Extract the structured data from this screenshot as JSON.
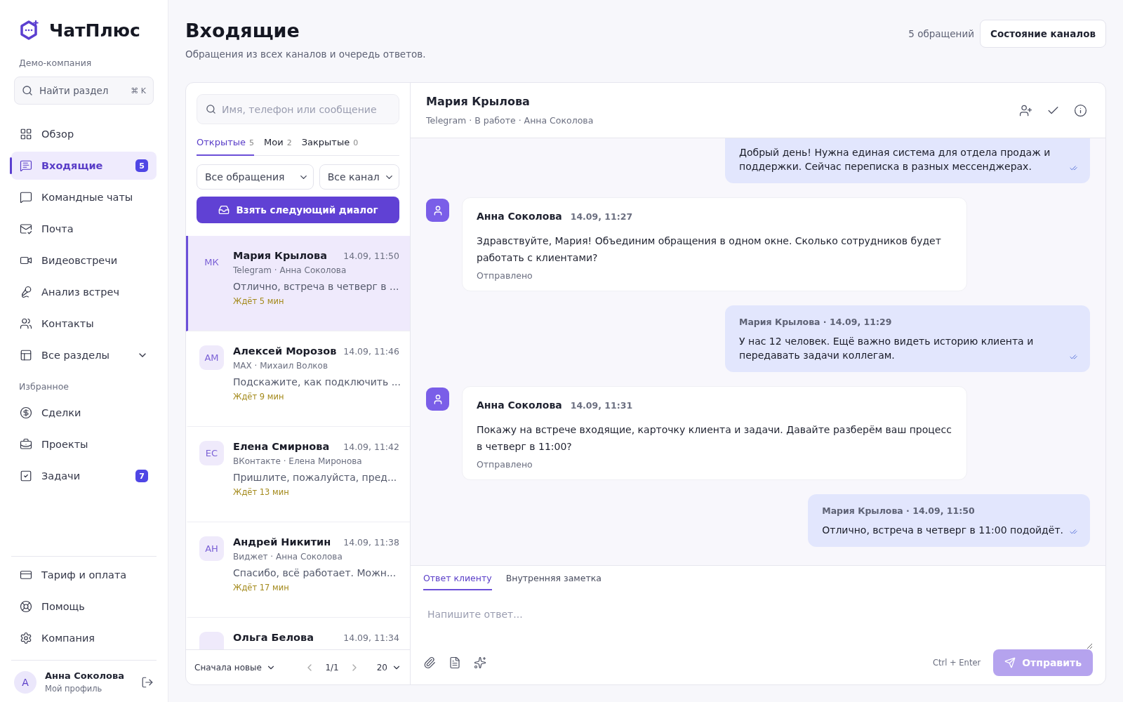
{
  "brand": {
    "name": "ЧатПлюс",
    "company": "Демо-компания"
  },
  "sidebar": {
    "search": {
      "placeholder": "Найти раздел",
      "shortcut": "⌘ K"
    },
    "items": [
      {
        "kind": "overview",
        "label": "Обзор",
        "selected": false
      },
      {
        "kind": "inbox",
        "label": "Входящие",
        "selected": true,
        "badge": "5"
      },
      {
        "kind": "team",
        "label": "Командные чаты",
        "selected": false
      },
      {
        "kind": "mail",
        "label": "Почта",
        "selected": false
      },
      {
        "kind": "video",
        "label": "Видеовстречи",
        "selected": false
      },
      {
        "kind": "analysis",
        "label": "Анализ встреч",
        "selected": false
      },
      {
        "kind": "contacts",
        "label": "Контакты",
        "selected": false
      },
      {
        "kind": "all",
        "label": "Все разделы",
        "selected": false,
        "expandable": true
      }
    ],
    "favorites_label": "Избранное",
    "favorites": [
      {
        "kind": "deals",
        "label": "Сделки",
        "selected": false
      },
      {
        "kind": "projects",
        "label": "Проекты",
        "selected": false
      },
      {
        "kind": "tasks",
        "label": "Задачи",
        "selected": false,
        "badge": "7"
      }
    ],
    "bottom": [
      {
        "kind": "billing",
        "label": "Тариф и оплата"
      },
      {
        "kind": "help",
        "label": "Помощь"
      },
      {
        "kind": "company",
        "label": "Компания"
      }
    ],
    "profile": {
      "initial": "А",
      "name": "Анна Соколова",
      "subtitle": "Мой профиль"
    }
  },
  "header": {
    "title": "Входящие",
    "subtitle": "Обращения из всех каналов и очередь ответов.",
    "count": "5 обращений",
    "button": "Состояние каналов"
  },
  "list": {
    "search": {
      "placeholder": "Имя, телефон или сообщение"
    },
    "tabs": [
      {
        "label": "Открытые",
        "count": "5",
        "selected": true
      },
      {
        "label": "Мои",
        "count": "2",
        "selected": false
      },
      {
        "label": "Закрытые",
        "count": "0",
        "selected": false
      }
    ],
    "filters": [
      "Все обращения",
      "Все канал"
    ],
    "take_button": "Взять следующий диалог",
    "conversations": [
      {
        "initials": "МК",
        "name": "Мария Крылова",
        "time": "14.09, 11:50",
        "meta": "Telegram · Анна Соколова",
        "preview": "Отлично, встреча в четверг в ...",
        "wait": "Ждёт 5 мин",
        "selected": true
      },
      {
        "initials": "АМ",
        "name": "Алексей Морозов",
        "time": "14.09, 11:46",
        "meta": "MAX · Михаил Волков",
        "preview": "Подскажите, как подключить ...",
        "wait": "Ждёт 9 мин",
        "selected": false
      },
      {
        "initials": "ЕС",
        "name": "Елена Смирнова",
        "time": "14.09, 11:42",
        "meta": "ВКонтакте · Елена Миронова",
        "preview": "Пришлите, пожалуйста, пред...",
        "wait": "Ждёт 13 мин",
        "selected": false
      },
      {
        "initials": "АН",
        "name": "Андрей Никитин",
        "time": "14.09, 11:38",
        "meta": "Виджет · Анна Соколова",
        "preview": "Спасибо, всё работает. Можн...",
        "wait": "Ждёт 17 мин",
        "selected": false
      },
      {
        "name": "Ольга Белова",
        "time": "14.09, 11:34",
        "selected": false
      }
    ],
    "footer": {
      "sort": "Сначала новые",
      "page": "1/1",
      "per_page": "20"
    }
  },
  "chat": {
    "name": "Мария Крылова",
    "meta": "Telegram · В работе · Анна Соколова",
    "messages": [
      {
        "kind": "client",
        "text": "Добрый день! Нужна единая система для отдела продаж и поддержки. Сейчас переписка в разных мессенджерах.",
        "read": true
      },
      {
        "kind": "agent",
        "author": "Анна Соколова",
        "time": "14.09, 11:27",
        "text": "Здравствуйте, Мария! Объединим обращения в одном окне. Сколько сотрудников будет работать с клиентами?",
        "status": "Отправлено"
      },
      {
        "kind": "client",
        "header": "Мария Крылова · 14.09, 11:29",
        "text": "У нас 12 человек. Ещё важно видеть историю клиента и передавать задачи коллегам.",
        "read": true
      },
      {
        "kind": "agent",
        "author": "Анна Соколова",
        "time": "14.09, 11:31",
        "text": "Покажу на встрече входящие, карточку клиента и задачи. Давайте разберём ваш процесс в четверг в 11:00?",
        "status": "Отправлено"
      },
      {
        "kind": "client",
        "header": "Мария Крылова · 14.09, 11:50",
        "text": "Отлично, встреча в четверг в 11:00 подойдёт.",
        "read": true
      }
    ],
    "composer": {
      "tabs": [
        {
          "label": "Ответ клиенту",
          "selected": true
        },
        {
          "label": "Внутренняя заметка",
          "selected": false
        }
      ],
      "placeholder": "Напишите ответ...",
      "hint": "Ctrl + Enter",
      "send": "Отправить",
      "send_disabled": true
    }
  }
}
